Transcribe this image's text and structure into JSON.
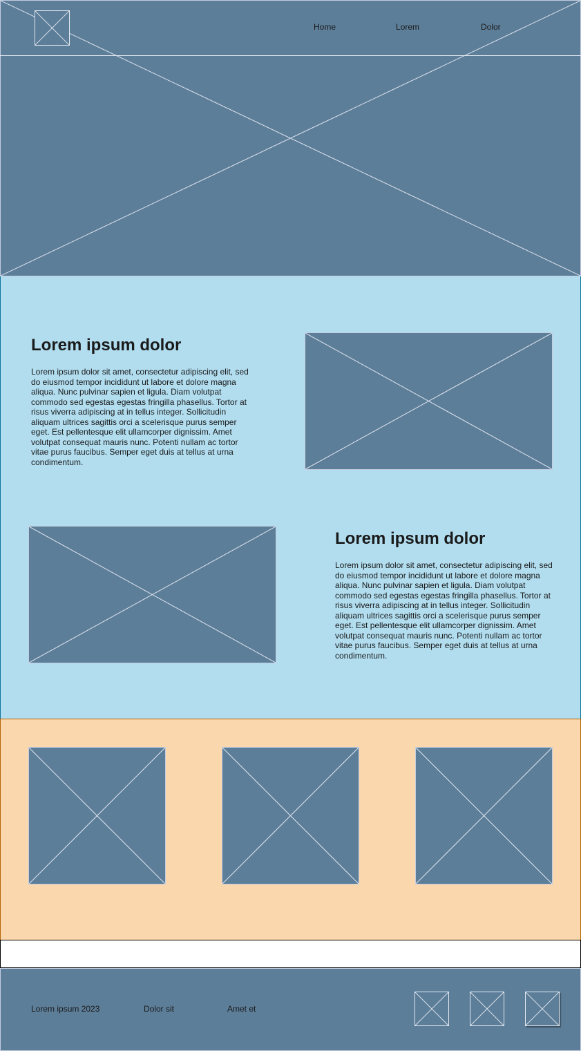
{
  "colors": {
    "placeholder": "#5d7e99",
    "placeholder_stroke": "#c4cde0",
    "content_bg": "#b1ddef",
    "gallery_bg": "#fad7ac",
    "gallery_border": "#b46504",
    "text": "#1a1a1a"
  },
  "header": {
    "logo_icon": "image-placeholder-icon",
    "nav": [
      {
        "label": "Home"
      },
      {
        "label": "Lorem"
      },
      {
        "label": "Dolor"
      }
    ]
  },
  "hero": {
    "icon": "image-placeholder-icon"
  },
  "content": {
    "blocks": [
      {
        "title": "Lorem ipsum dolor",
        "text": "Lorem ipsum dolor sit amet, consectetur adipiscing elit, sed do eiusmod tempor incididunt ut labore et dolore magna aliqua. Nunc pulvinar sapien et ligula. Diam volutpat commodo sed egestas egestas fringilla phasellus. Tortor at risus viverra adipiscing at in tellus integer. Sollicitudin aliquam ultrices sagittis orci a scelerisque purus semper eget. Est pellentesque elit ullamcorper dignissim. Amet volutpat consequat mauris nunc. Potenti nullam ac tortor vitae purus faucibus. Semper eget duis at tellus at urna condimentum.",
        "image_icon": "image-placeholder-icon"
      },
      {
        "title": "Lorem ipsum dolor",
        "text": "Lorem ipsum dolor sit amet, consectetur adipiscing elit, sed do eiusmod tempor incididunt ut labore et dolore magna aliqua. Nunc pulvinar sapien et ligula. Diam volutpat commodo sed egestas egestas fringilla phasellus. Tortor at risus viverra adipiscing at in tellus integer. Sollicitudin aliquam ultrices sagittis orci a scelerisque purus semper eget. Est pellentesque elit ullamcorper dignissim. Amet volutpat consequat mauris nunc. Potenti nullam ac tortor vitae purus faucibus. Semper eget duis at tellus at urna condimentum.",
        "image_icon": "image-placeholder-icon"
      }
    ]
  },
  "gallery": {
    "items": [
      {
        "icon": "image-placeholder-icon"
      },
      {
        "icon": "image-placeholder-icon"
      },
      {
        "icon": "image-placeholder-icon"
      }
    ]
  },
  "footer": {
    "links": [
      {
        "label": "Lorem ipsum 2023"
      },
      {
        "label": "Dolor sit"
      },
      {
        "label": "Amet et"
      }
    ],
    "social_icons": [
      "social-placeholder-icon",
      "social-placeholder-icon",
      "social-placeholder-icon"
    ]
  }
}
